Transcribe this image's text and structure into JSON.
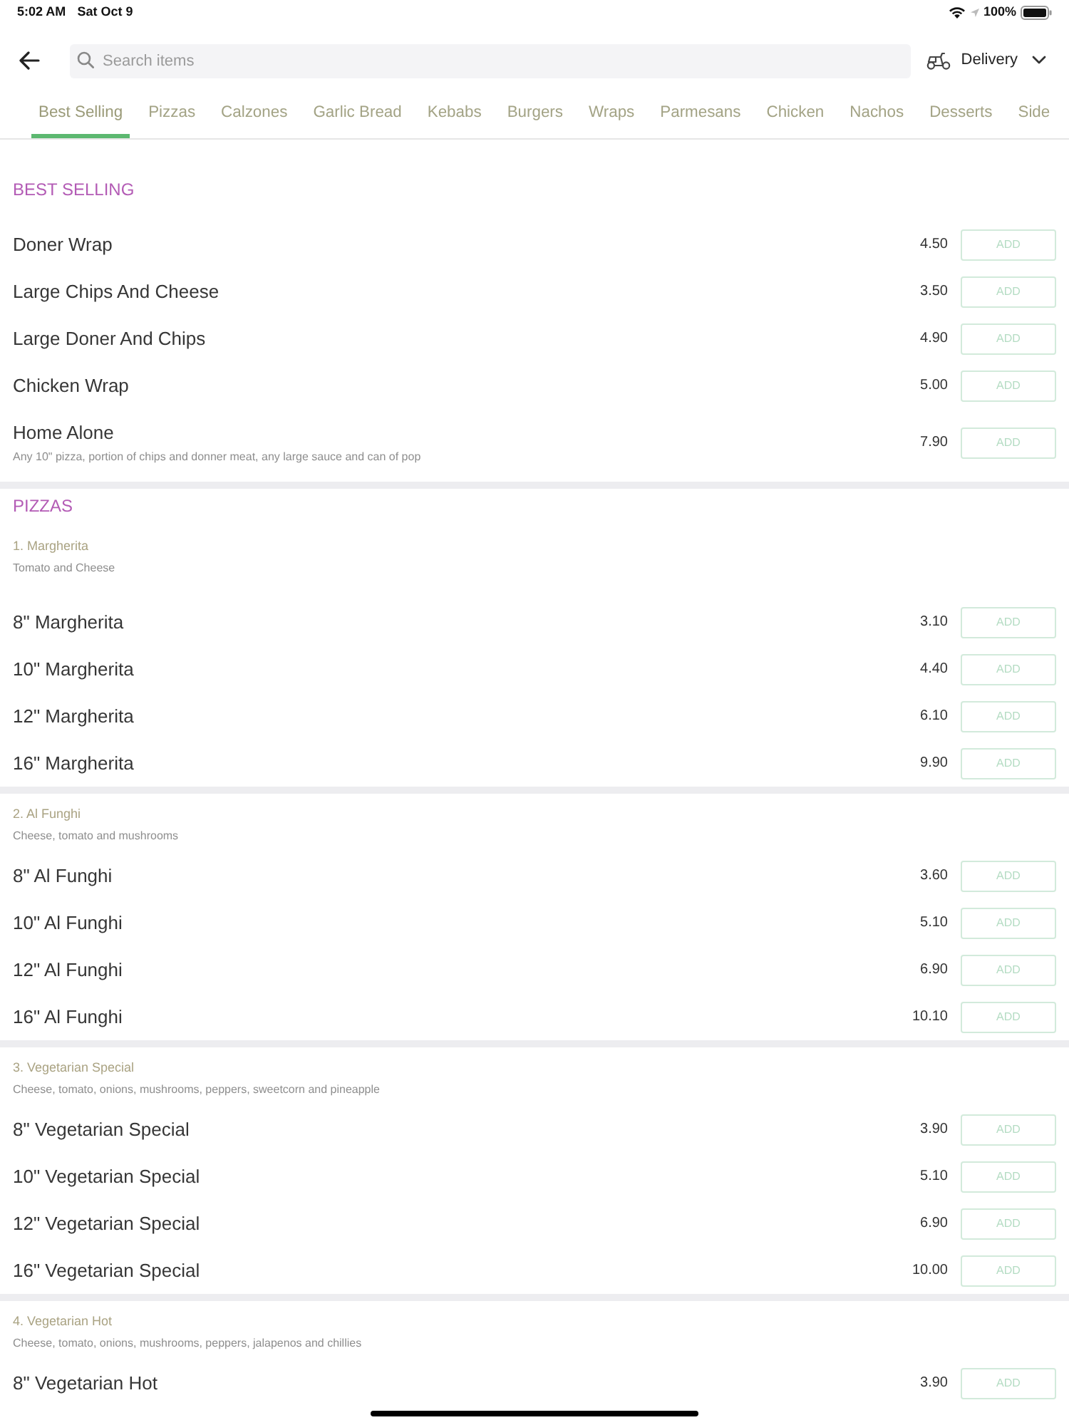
{
  "status_bar": {
    "time": "5:02 AM",
    "date": "Sat Oct 9",
    "battery": "100%"
  },
  "header": {
    "search": {
      "placeholder": "Search items"
    },
    "mode": "Delivery"
  },
  "tabs": [
    {
      "label": "Best Selling",
      "selected": true
    },
    {
      "label": "Pizzas",
      "selected": false
    },
    {
      "label": "Calzones",
      "selected": false
    },
    {
      "label": "Garlic Bread",
      "selected": false
    },
    {
      "label": "Kebabs",
      "selected": false
    },
    {
      "label": "Burgers",
      "selected": false
    },
    {
      "label": "Wraps",
      "selected": false
    },
    {
      "label": "Parmesans",
      "selected": false
    },
    {
      "label": "Chicken",
      "selected": false
    },
    {
      "label": "Nachos",
      "selected": false
    },
    {
      "label": "Desserts",
      "selected": false
    },
    {
      "label": "Side",
      "selected": false
    }
  ],
  "sections": [
    {
      "title": "BEST SELLING",
      "groups": [
        {
          "items": [
            {
              "name": "Doner Wrap",
              "price": "4.50",
              "button": "ADD"
            },
            {
              "name": "Large Chips And Cheese",
              "price": "3.50",
              "button": "ADD"
            },
            {
              "name": "Large Doner And Chips",
              "price": "4.90",
              "button": "ADD"
            },
            {
              "name": "Chicken Wrap",
              "price": "5.00",
              "button": "ADD"
            },
            {
              "name": "Home Alone",
              "description": "Any 10\" pizza, portion of chips and donner meat, any large sauce and can of pop",
              "price": "7.90",
              "button": "ADD"
            }
          ]
        }
      ]
    },
    {
      "title": "PIZZAS",
      "groups": [
        {
          "title": "1. Margherita",
          "description": "Tomato and Cheese",
          "items": [
            {
              "name": "8\" Margherita",
              "price": "3.10",
              "button": "ADD"
            },
            {
              "name": "10\" Margherita",
              "price": "4.40",
              "button": "ADD"
            },
            {
              "name": "12\" Margherita",
              "price": "6.10",
              "button": "ADD"
            },
            {
              "name": "16\" Margherita",
              "price": "9.90",
              "button": "ADD"
            }
          ]
        },
        {
          "title": "2. Al Funghi",
          "description": "Cheese, tomato and mushrooms",
          "items": [
            {
              "name": "8\" Al Funghi",
              "price": "3.60",
              "button": "ADD"
            },
            {
              "name": "10\" Al Funghi",
              "price": "5.10",
              "button": "ADD"
            },
            {
              "name": "12\" Al Funghi",
              "price": "6.90",
              "button": "ADD"
            },
            {
              "name": "16\" Al Funghi",
              "price": "10.10",
              "button": "ADD"
            }
          ]
        },
        {
          "title": "3. Vegetarian Special",
          "description": "Cheese, tomato, onions, mushrooms, peppers, sweetcorn and pineapple",
          "items": [
            {
              "name": "8\" Vegetarian Special",
              "price": "3.90",
              "button": "ADD"
            },
            {
              "name": "10\" Vegetarian Special",
              "price": "5.10",
              "button": "ADD"
            },
            {
              "name": "12\" Vegetarian Special",
              "price": "6.90",
              "button": "ADD"
            },
            {
              "name": "16\" Vegetarian Special",
              "price": "10.00",
              "button": "ADD"
            }
          ]
        },
        {
          "title": "4. Vegetarian Hot",
          "description": "Cheese, tomato, onions, mushrooms, peppers, jalapenos and chillies",
          "items": [
            {
              "name": "8\" Vegetarian Hot",
              "price": "3.90",
              "button": "ADD"
            }
          ]
        }
      ]
    }
  ]
}
